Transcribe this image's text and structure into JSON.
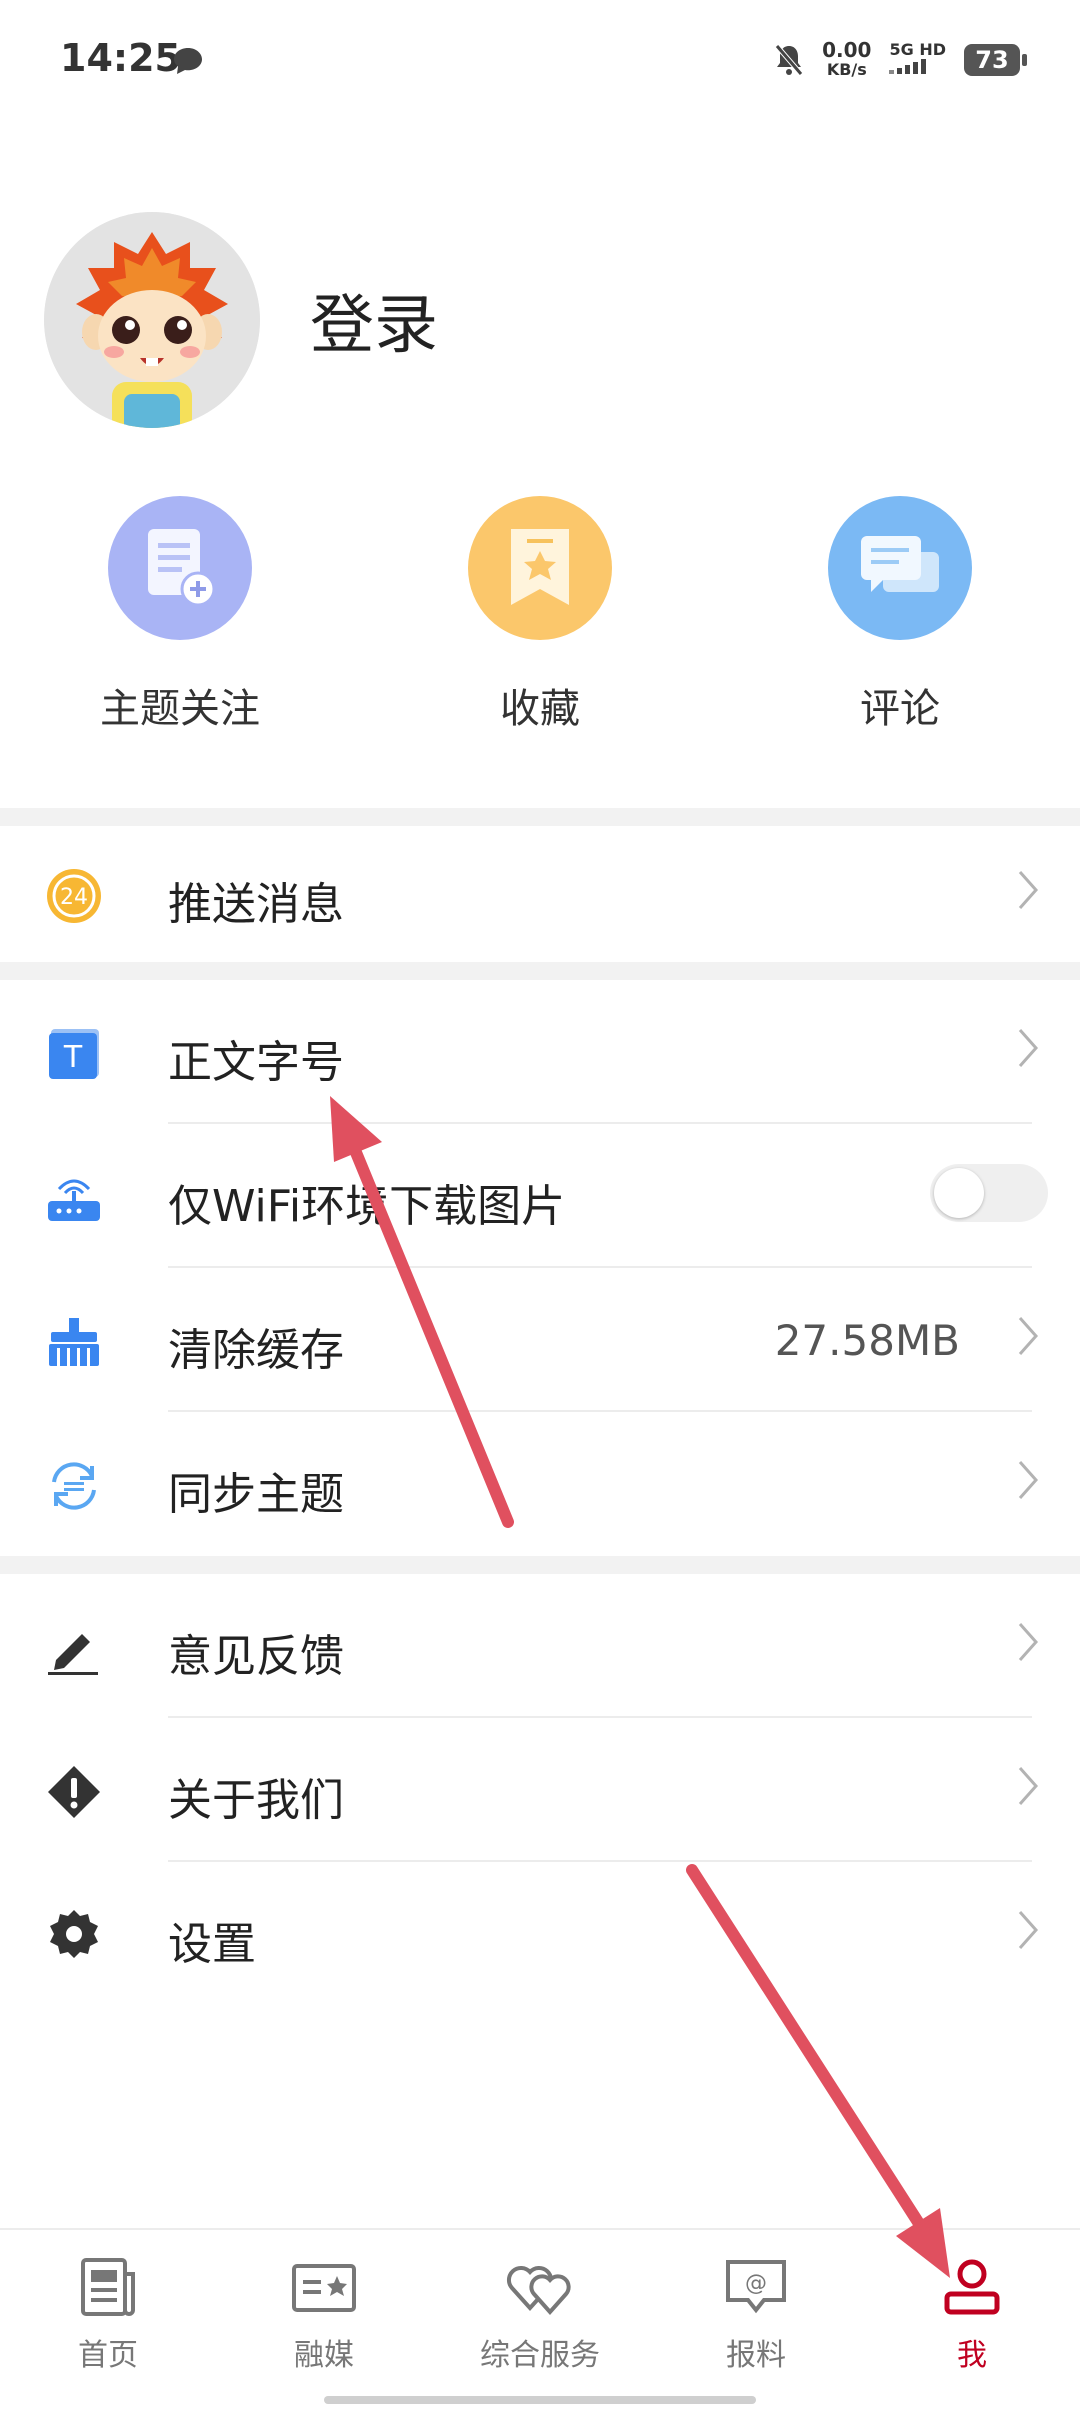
{
  "status_bar": {
    "time": "14:25",
    "speed_value": "0.00",
    "speed_unit": "KB/s",
    "network": "5G HD",
    "battery": "73"
  },
  "profile": {
    "login_label": "登录"
  },
  "quick_actions": [
    {
      "label": "主题关注",
      "color": "#a9b4f5"
    },
    {
      "label": "收藏",
      "color": "#fbc76b"
    },
    {
      "label": "评论",
      "color": "#7bb9f4"
    }
  ],
  "menu": {
    "push": {
      "label": "推送消息"
    },
    "font_size": {
      "label": "正文字号"
    },
    "wifi_images": {
      "label": "仅WiFi环境下载图片",
      "enabled": false
    },
    "clear_cache": {
      "label": "清除缓存",
      "value": "27.58MB"
    },
    "sync_topics": {
      "label": "同步主题"
    },
    "feedback": {
      "label": "意见反馈"
    },
    "about": {
      "label": "关于我们"
    },
    "settings": {
      "label": "设置"
    }
  },
  "tabs": [
    {
      "label": "首页",
      "active": false
    },
    {
      "label": "融媒",
      "active": false
    },
    {
      "label": "综合服务",
      "active": false
    },
    {
      "label": "报料",
      "active": false
    },
    {
      "label": "我",
      "active": true
    }
  ],
  "colors": {
    "accent": "#c00020",
    "annotation_arrow": "#e0505f"
  }
}
